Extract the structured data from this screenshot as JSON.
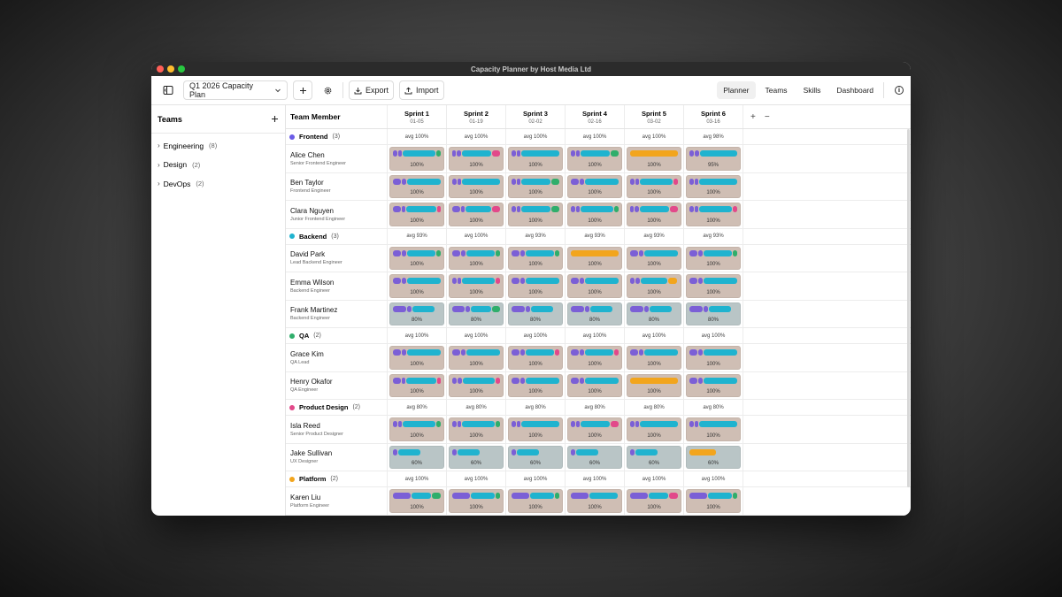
{
  "window": {
    "title": "Capacity Planner by Host Media Ltd"
  },
  "toolbar": {
    "plan": "Q1 2026 Capacity Plan",
    "export": "Export",
    "import": "Import",
    "nav": [
      "Planner",
      "Teams",
      "Skills",
      "Dashboard"
    ],
    "active_nav": "Planner"
  },
  "sidebar": {
    "title": "Teams",
    "items": [
      {
        "label": "Engineering",
        "count": "(8)"
      },
      {
        "label": "Design",
        "count": "(2)"
      },
      {
        "label": "DevOps",
        "count": "(2)"
      }
    ]
  },
  "grid": {
    "header": "Team Member",
    "sprints": [
      {
        "name": "Sprint 1",
        "date": "01-05"
      },
      {
        "name": "Sprint 2",
        "date": "01-19"
      },
      {
        "name": "Sprint 3",
        "date": "02-02"
      },
      {
        "name": "Sprint 4",
        "date": "02-16"
      },
      {
        "name": "Sprint 5",
        "date": "03-02"
      },
      {
        "name": "Sprint 6",
        "date": "03-16"
      }
    ]
  },
  "colors": {
    "purple": "#7b5fd6",
    "cyan": "#1fb3cf",
    "green": "#2fae6b",
    "pink": "#e2498a",
    "orange": "#f2a51d"
  },
  "teams": [
    {
      "name": "Frontend",
      "count": "(3)",
      "color": "#6b5ce7",
      "avg": [
        "avg 100%",
        "avg 100%",
        "avg 100%",
        "avg 100%",
        "avg 100%",
        "avg 98%"
      ],
      "members": [
        {
          "name": "Alice Chen",
          "role": "Senior Frontend Engineer",
          "cells": [
            {
              "pct": "100%",
              "bars": [
                "purple:5",
                "purple:5",
                "cyan:40",
                "green:5"
              ]
            },
            {
              "pct": "100%",
              "bars": [
                "purple:5",
                "purple:5",
                "cyan:37",
                "pink:10"
              ]
            },
            {
              "pct": "100%",
              "bars": [
                "purple:5",
                "purple:5",
                "cyan:47"
              ]
            },
            {
              "pct": "100%",
              "bars": [
                "purple:5",
                "purple:5",
                "cyan:35",
                "green:10"
              ]
            },
            {
              "pct": "100%",
              "bars": [
                "orange:60"
              ]
            },
            {
              "pct": "95%",
              "bars": [
                "purple:5",
                "purple:5",
                "cyan:42"
              ]
            }
          ]
        },
        {
          "name": "Ben Taylor",
          "role": "Frontend Engineer",
          "cells": [
            {
              "pct": "100%",
              "bars": [
                "purple:10",
                "purple:5",
                "cyan:42"
              ]
            },
            {
              "pct": "100%",
              "bars": [
                "purple:5",
                "purple:5",
                "cyan:47"
              ]
            },
            {
              "pct": "100%",
              "bars": [
                "purple:5",
                "purple:5",
                "cyan:35",
                "green:10"
              ]
            },
            {
              "pct": "100%",
              "bars": [
                "purple:10",
                "purple:5",
                "cyan:42"
              ]
            },
            {
              "pct": "100%",
              "bars": [
                "purple:5",
                "purple:5",
                "cyan:40",
                "pink:5"
              ]
            },
            {
              "pct": "100%",
              "bars": [
                "purple:5",
                "purple:5",
                "cyan:47"
              ]
            }
          ]
        },
        {
          "name": "Clara Nguyen",
          "role": "Junior Frontend Engineer",
          "cells": [
            {
              "pct": "100%",
              "bars": [
                "purple:10",
                "purple:5",
                "cyan:37",
                "pink:5"
              ]
            },
            {
              "pct": "100%",
              "bars": [
                "purple:10",
                "purple:5",
                "cyan:32",
                "pink:10"
              ]
            },
            {
              "pct": "100%",
              "bars": [
                "purple:5",
                "purple:5",
                "cyan:35",
                "green:10"
              ]
            },
            {
              "pct": "100%",
              "bars": [
                "purple:5",
                "purple:5",
                "cyan:40",
                "green:5"
              ]
            },
            {
              "pct": "100%",
              "bars": [
                "purple:5",
                "purple:5",
                "cyan:37",
                "pink:10"
              ]
            },
            {
              "pct": "100%",
              "bars": [
                "purple:5",
                "purple:5",
                "cyan:40",
                "pink:5"
              ]
            }
          ]
        }
      ]
    },
    {
      "name": "Backend",
      "count": "(3)",
      "color": "#1fb3cf",
      "avg": [
        "avg 93%",
        "avg 100%",
        "avg 93%",
        "avg 93%",
        "avg 93%",
        "avg 93%"
      ],
      "members": [
        {
          "name": "David Park",
          "role": "Lead Backend Engineer",
          "cells": [
            {
              "pct": "100%",
              "bars": [
                "purple:10",
                "purple:5",
                "cyan:35",
                "green:5"
              ]
            },
            {
              "pct": "100%",
              "bars": [
                "purple:10",
                "purple:5",
                "cyan:35",
                "green:5"
              ]
            },
            {
              "pct": "100%",
              "bars": [
                "purple:10",
                "purple:5",
                "cyan:35",
                "green:5"
              ]
            },
            {
              "pct": "100%",
              "bars": [
                "orange:60"
              ]
            },
            {
              "pct": "100%",
              "bars": [
                "purple:10",
                "purple:5",
                "cyan:42"
              ]
            },
            {
              "pct": "100%",
              "bars": [
                "purple:10",
                "purple:5",
                "cyan:35",
                "green:5"
              ]
            }
          ]
        },
        {
          "name": "Emma Wilson",
          "role": "Backend Engineer",
          "cells": [
            {
              "pct": "100%",
              "bars": [
                "purple:10",
                "purple:5",
                "cyan:42"
              ]
            },
            {
              "pct": "100%",
              "bars": [
                "purple:5",
                "purple:5",
                "cyan:40",
                "pink:5"
              ]
            },
            {
              "pct": "100%",
              "bars": [
                "purple:10",
                "purple:5",
                "cyan:42"
              ]
            },
            {
              "pct": "100%",
              "bars": [
                "purple:10",
                "purple:5",
                "cyan:42"
              ]
            },
            {
              "pct": "100%",
              "bars": [
                "purple:5",
                "purple:5",
                "cyan:30",
                "orange:10"
              ]
            },
            {
              "pct": "100%",
              "bars": [
                "purple:10",
                "purple:5",
                "cyan:42"
              ]
            }
          ]
        },
        {
          "name": "Frank Martinez",
          "role": "Backend Engineer",
          "cells": [
            {
              "pct": "80%",
              "bars": [
                "purple:15",
                "purple:5",
                "cyan:25"
              ]
            },
            {
              "pct": "80%",
              "bars": [
                "purple:15",
                "purple:5",
                "cyan:25",
                "green:10"
              ]
            },
            {
              "pct": "80%",
              "bars": [
                "purple:15",
                "purple:5",
                "cyan:25"
              ]
            },
            {
              "pct": "80%",
              "bars": [
                "purple:15",
                "purple:5",
                "cyan:25"
              ]
            },
            {
              "pct": "80%",
              "bars": [
                "purple:15",
                "purple:5",
                "cyan:25"
              ]
            },
            {
              "pct": "80%",
              "bars": [
                "purple:15",
                "purple:5",
                "cyan:25"
              ]
            }
          ]
        }
      ]
    },
    {
      "name": "QA",
      "count": "(2)",
      "color": "#2fae6b",
      "avg": [
        "avg 100%",
        "avg 100%",
        "avg 100%",
        "avg 100%",
        "avg 100%",
        "avg 100%"
      ],
      "members": [
        {
          "name": "Grace Kim",
          "role": "QA Lead",
          "cells": [
            {
              "pct": "100%",
              "bars": [
                "purple:10",
                "purple:5",
                "cyan:42"
              ]
            },
            {
              "pct": "100%",
              "bars": [
                "purple:10",
                "purple:5",
                "cyan:42"
              ]
            },
            {
              "pct": "100%",
              "bars": [
                "purple:10",
                "purple:5",
                "cyan:35",
                "pink:5"
              ]
            },
            {
              "pct": "100%",
              "bars": [
                "purple:10",
                "purple:5",
                "cyan:35",
                "pink:5"
              ]
            },
            {
              "pct": "100%",
              "bars": [
                "purple:10",
                "purple:5",
                "cyan:42"
              ]
            },
            {
              "pct": "100%",
              "bars": [
                "purple:10",
                "purple:5",
                "cyan:42"
              ]
            }
          ]
        },
        {
          "name": "Henry Okafor",
          "role": "QA Engineer",
          "cells": [
            {
              "pct": "100%",
              "bars": [
                "purple:10",
                "purple:5",
                "cyan:37",
                "pink:5"
              ]
            },
            {
              "pct": "100%",
              "bars": [
                "purple:5",
                "purple:5",
                "cyan:37",
                "pink:5"
              ]
            },
            {
              "pct": "100%",
              "bars": [
                "purple:10",
                "purple:5",
                "cyan:42"
              ]
            },
            {
              "pct": "100%",
              "bars": [
                "purple:10",
                "purple:5",
                "cyan:42"
              ]
            },
            {
              "pct": "100%",
              "bars": [
                "orange:60"
              ]
            },
            {
              "pct": "100%",
              "bars": [
                "purple:10",
                "purple:5",
                "cyan:42"
              ]
            }
          ]
        }
      ]
    },
    {
      "name": "Product Design",
      "count": "(2)",
      "color": "#e2498a",
      "avg": [
        "avg 80%",
        "avg 80%",
        "avg 80%",
        "avg 80%",
        "avg 80%",
        "avg 80%"
      ],
      "members": [
        {
          "name": "Isla Reed",
          "role": "Senior Product Designer",
          "cells": [
            {
              "pct": "100%",
              "bars": [
                "purple:5",
                "purple:5",
                "cyan:40",
                "green:5"
              ]
            },
            {
              "pct": "100%",
              "bars": [
                "purple:5",
                "purple:5",
                "cyan:40",
                "green:5"
              ]
            },
            {
              "pct": "100%",
              "bars": [
                "purple:5",
                "purple:5",
                "cyan:47"
              ]
            },
            {
              "pct": "100%",
              "bars": [
                "purple:5",
                "purple:5",
                "cyan:35",
                "pink:10"
              ]
            },
            {
              "pct": "100%",
              "bars": [
                "purple:5",
                "purple:5",
                "cyan:47"
              ]
            },
            {
              "pct": "100%",
              "bars": [
                "purple:5",
                "purple:5",
                "cyan:47"
              ]
            }
          ]
        },
        {
          "name": "Jake Sullivan",
          "role": "UX Designer",
          "cells": [
            {
              "pct": "60%",
              "bars": [
                "purple:5",
                "cyan:25"
              ]
            },
            {
              "pct": "60%",
              "bars": [
                "purple:5",
                "cyan:25"
              ]
            },
            {
              "pct": "60%",
              "bars": [
                "purple:5",
                "cyan:25"
              ]
            },
            {
              "pct": "60%",
              "bars": [
                "purple:5",
                "cyan:25"
              ]
            },
            {
              "pct": "60%",
              "bars": [
                "purple:5",
                "cyan:25"
              ]
            },
            {
              "pct": "60%",
              "bars": [
                "orange:30"
              ]
            }
          ]
        }
      ]
    },
    {
      "name": "Platform",
      "count": "(2)",
      "color": "#f2a51d",
      "avg": [
        "avg 100%",
        "avg 100%",
        "avg 100%",
        "avg 100%",
        "avg 100%",
        "avg 100%"
      ],
      "members": [
        {
          "name": "Karen Liu",
          "role": "Platform Engineer",
          "cells": [
            {
              "pct": "100%",
              "bars": [
                "purple:20",
                "cyan:22",
                "green:10"
              ]
            },
            {
              "pct": "100%",
              "bars": [
                "purple:20",
                "cyan:27",
                "green:5"
              ]
            },
            {
              "pct": "100%",
              "bars": [
                "purple:20",
                "cyan:27",
                "green:5"
              ]
            },
            {
              "pct": "100%",
              "bars": [
                "purple:20",
                "cyan:32"
              ]
            },
            {
              "pct": "100%",
              "bars": [
                "purple:20",
                "cyan:22",
                "pink:10"
              ]
            },
            {
              "pct": "100%",
              "bars": [
                "purple:20",
                "cyan:27",
                "green:5"
              ]
            }
          ]
        }
      ]
    }
  ]
}
